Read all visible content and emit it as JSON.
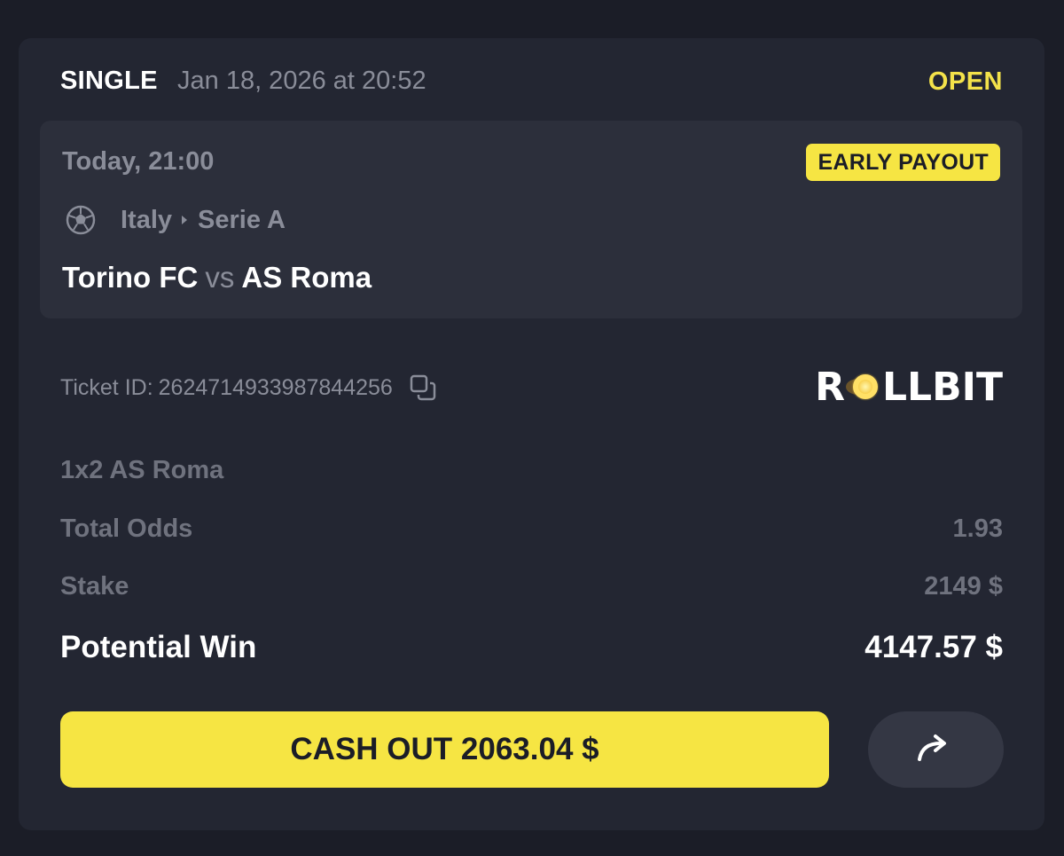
{
  "header": {
    "bet_type": "SINGLE",
    "date": "Jan 18, 2026 at 20:52",
    "status": "OPEN"
  },
  "event": {
    "time": "Today, 21:00",
    "badge": "EARLY PAYOUT",
    "sport_icon": "soccer-ball-icon",
    "country": "Italy",
    "league": "Serie A",
    "home_team": "Torino FC",
    "vs": "vs",
    "away_team": "AS Roma"
  },
  "ticket": {
    "label": "Ticket ID:",
    "id": "2624714933987844256"
  },
  "logo": {
    "text": "ROLLBIT",
    "left_part": "R",
    "right_part": "LLBIT"
  },
  "details": {
    "selection": "1x2 AS Roma",
    "odds_label": "Total Odds",
    "odds_value": "1.93",
    "stake_label": "Stake",
    "stake_value": "2149 $",
    "win_label": "Potential Win",
    "win_value": "4147.57 $"
  },
  "actions": {
    "cashout_label": "CASH OUT 2063.04 $",
    "share_icon": "share-arrow-icon"
  },
  "colors": {
    "background": "#1b1d27",
    "card": "#232632",
    "accent": "#f6e543",
    "muted": "#8a8d99"
  }
}
